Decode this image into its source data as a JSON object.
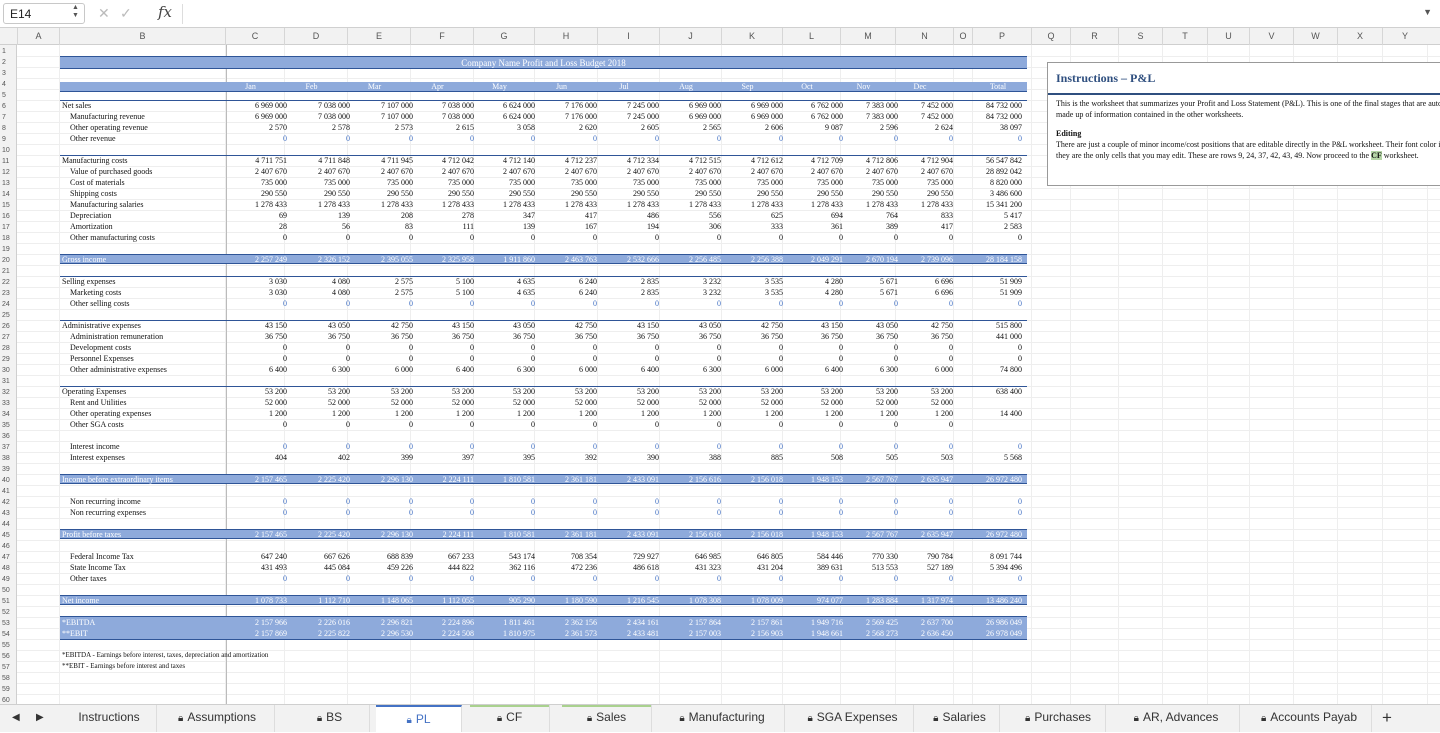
{
  "formula_bar": {
    "name_box": "E14",
    "cancel_icon": "✕",
    "enter_icon": "✓",
    "fx": "fx"
  },
  "columns": [
    "A",
    "B",
    "C",
    "D",
    "E",
    "F",
    "G",
    "H",
    "I",
    "J",
    "K",
    "L",
    "M",
    "N",
    "O",
    "P",
    "Q",
    "R",
    "S",
    "T",
    "U",
    "V",
    "W",
    "X",
    "Y"
  ],
  "rows": [
    "1",
    "2",
    "3",
    "4",
    "5",
    "6",
    "7",
    "8",
    "9",
    "10",
    "11",
    "12",
    "13",
    "14",
    "15",
    "16",
    "17",
    "18",
    "19",
    "20",
    "21",
    "22",
    "23",
    "24",
    "25",
    "26",
    "27",
    "28",
    "29",
    "30",
    "31",
    "32",
    "33",
    "34",
    "35",
    "36",
    "37",
    "38",
    "39",
    "40",
    "41",
    "42",
    "43",
    "44",
    "45",
    "46",
    "47",
    "48",
    "49",
    "50",
    "51",
    "52",
    "53",
    "54",
    "55",
    "56",
    "57",
    "58",
    "59",
    "60"
  ],
  "sheet": {
    "title": "Company Name Profit and Loss Budget 2018",
    "months": [
      "Jan",
      "Feb",
      "Mar",
      "Apr",
      "May",
      "Jun",
      "Jul",
      "Aug",
      "Sep",
      "Oct",
      "Nov",
      "Dec",
      "Total"
    ],
    "rows": [
      {
        "label": "Net sales",
        "type": "section",
        "values": [
          "6 969 000",
          "7 038 000",
          "7 107 000",
          "7 038 000",
          "6 624 000",
          "7 176 000",
          "7 245 000",
          "6 969 000",
          "6 969 000",
          "6 762 000",
          "7 383 000",
          "7 452 000",
          "84 732 000"
        ]
      },
      {
        "label": "Manufacturing revenue",
        "type": "sub",
        "values": [
          "6 969 000",
          "7 038 000",
          "7 107 000",
          "7 038 000",
          "6 624 000",
          "7 176 000",
          "7 245 000",
          "6 969 000",
          "6 969 000",
          "6 762 000",
          "7 383 000",
          "7 452 000",
          "84 732 000"
        ]
      },
      {
        "label": "Other operating revenue",
        "type": "sub",
        "values": [
          "2 570",
          "2 578",
          "2 573",
          "2 615",
          "3 058",
          "2 620",
          "2 605",
          "2 565",
          "2 606",
          "9 087",
          "2 596",
          "2 624",
          "38 097"
        ]
      },
      {
        "label": "Other revenue",
        "type": "sub",
        "blue": true,
        "values": [
          "0",
          "0",
          "0",
          "0",
          "0",
          "0",
          "0",
          "0",
          "0",
          "0",
          "0",
          "0",
          "0"
        ]
      },
      {
        "label": "Manufacturing costs",
        "type": "section",
        "values": [
          "4 711 751",
          "4 711 848",
          "4 711 945",
          "4 712 042",
          "4 712 140",
          "4 712 237",
          "4 712 334",
          "4 712 515",
          "4 712 612",
          "4 712 709",
          "4 712 806",
          "4 712 904",
          "56 547 842"
        ]
      },
      {
        "label": "Value of purchased goods",
        "type": "sub",
        "values": [
          "2 407 670",
          "2 407 670",
          "2 407 670",
          "2 407 670",
          "2 407 670",
          "2 407 670",
          "2 407 670",
          "2 407 670",
          "2 407 670",
          "2 407 670",
          "2 407 670",
          "2 407 670",
          "28 892 042"
        ]
      },
      {
        "label": "Cost of materials",
        "type": "sub",
        "values": [
          "735 000",
          "735 000",
          "735 000",
          "735 000",
          "735 000",
          "735 000",
          "735 000",
          "735 000",
          "735 000",
          "735 000",
          "735 000",
          "735 000",
          "8 820 000"
        ]
      },
      {
        "label": "Shipping costs",
        "type": "sub",
        "values": [
          "290 550",
          "290 550",
          "290 550",
          "290 550",
          "290 550",
          "290 550",
          "290 550",
          "290 550",
          "290 550",
          "290 550",
          "290 550",
          "290 550",
          "3 486 600"
        ]
      },
      {
        "label": "Manufacturing salaries",
        "type": "sub",
        "values": [
          "1 278 433",
          "1 278 433",
          "1 278 433",
          "1 278 433",
          "1 278 433",
          "1 278 433",
          "1 278 433",
          "1 278 433",
          "1 278 433",
          "1 278 433",
          "1 278 433",
          "1 278 433",
          "15 341 200"
        ]
      },
      {
        "label": "Depreciation",
        "type": "sub",
        "values": [
          "69",
          "139",
          "208",
          "278",
          "347",
          "417",
          "486",
          "556",
          "625",
          "694",
          "764",
          "833",
          "5 417"
        ]
      },
      {
        "label": "Amortization",
        "type": "sub",
        "values": [
          "28",
          "56",
          "83",
          "111",
          "139",
          "167",
          "194",
          "306",
          "333",
          "361",
          "389",
          "417",
          "2 583"
        ]
      },
      {
        "label": "Other manufacturing costs",
        "type": "sub",
        "values": [
          "0",
          "0",
          "0",
          "0",
          "0",
          "0",
          "0",
          "0",
          "0",
          "0",
          "0",
          "0",
          "0"
        ]
      },
      {
        "label": "Gross income",
        "type": "bar",
        "values": [
          "2 257 249",
          "2 326 152",
          "2 395 055",
          "2 325 958",
          "1 911 860",
          "2 463 763",
          "2 532 666",
          "2 256 485",
          "2 256 388",
          "2 049 291",
          "2 670 194",
          "2 739 096",
          "28 184 158"
        ]
      },
      {
        "label": "Selling expenses",
        "type": "section",
        "values": [
          "3 030",
          "4 080",
          "2 575",
          "5 100",
          "4 635",
          "6 240",
          "2 835",
          "3 232",
          "3 535",
          "4 280",
          "5 671",
          "6 696",
          "51 909"
        ]
      },
      {
        "label": "Marketing costs",
        "type": "sub",
        "values": [
          "3 030",
          "4 080",
          "2 575",
          "5 100",
          "4 635",
          "6 240",
          "2 835",
          "3 232",
          "3 535",
          "4 280",
          "5 671",
          "6 696",
          "51 909"
        ]
      },
      {
        "label": "Other selling costs",
        "type": "sub",
        "blue": true,
        "values": [
          "0",
          "0",
          "0",
          "0",
          "0",
          "0",
          "0",
          "0",
          "0",
          "0",
          "0",
          "0",
          "0"
        ]
      },
      {
        "label": "Administrative expenses",
        "type": "section",
        "values": [
          "43 150",
          "43 050",
          "42 750",
          "43 150",
          "43 050",
          "42 750",
          "43 150",
          "43 050",
          "42 750",
          "43 150",
          "43 050",
          "42 750",
          "515 800"
        ]
      },
      {
        "label": "Administration remuneration",
        "type": "sub",
        "values": [
          "36 750",
          "36 750",
          "36 750",
          "36 750",
          "36 750",
          "36 750",
          "36 750",
          "36 750",
          "36 750",
          "36 750",
          "36 750",
          "36 750",
          "441 000"
        ]
      },
      {
        "label": "Development costs",
        "type": "sub",
        "values": [
          "0",
          "0",
          "0",
          "0",
          "0",
          "0",
          "0",
          "0",
          "0",
          "0",
          "0",
          "0",
          "0"
        ]
      },
      {
        "label": "Personnel Expenses",
        "type": "sub",
        "values": [
          "0",
          "0",
          "0",
          "0",
          "0",
          "0",
          "0",
          "0",
          "0",
          "0",
          "0",
          "0",
          "0"
        ]
      },
      {
        "label": "Other administrative expenses",
        "type": "sub",
        "values": [
          "6 400",
          "6 300",
          "6 000",
          "6 400",
          "6 300",
          "6 000",
          "6 400",
          "6 300",
          "6 000",
          "6 400",
          "6 300",
          "6 000",
          "74 800"
        ]
      },
      {
        "label": "Operating Expenses",
        "type": "section",
        "values": [
          "53 200",
          "53 200",
          "53 200",
          "53 200",
          "53 200",
          "53 200",
          "53 200",
          "53 200",
          "53 200",
          "53 200",
          "53 200",
          "53 200",
          "638 400"
        ]
      },
      {
        "label": "Rent and Utilities",
        "type": "sub",
        "values": [
          "52 000",
          "52 000",
          "52 000",
          "52 000",
          "52 000",
          "52 000",
          "52 000",
          "52 000",
          "52 000",
          "52 000",
          "52 000",
          "52 000",
          ""
        ]
      },
      {
        "label": "Other operating expenses",
        "type": "sub",
        "values": [
          "1 200",
          "1 200",
          "1 200",
          "1 200",
          "1 200",
          "1 200",
          "1 200",
          "1 200",
          "1 200",
          "1 200",
          "1 200",
          "1 200",
          "14 400"
        ]
      },
      {
        "label": "Other SGA costs",
        "type": "sub",
        "values": [
          "0",
          "0",
          "0",
          "0",
          "0",
          "0",
          "0",
          "0",
          "0",
          "0",
          "0",
          "0",
          ""
        ]
      },
      {
        "label": "Interest income",
        "type": "sub",
        "blue": true,
        "values": [
          "0",
          "0",
          "0",
          "0",
          "0",
          "0",
          "0",
          "0",
          "0",
          "0",
          "0",
          "0",
          "0"
        ]
      },
      {
        "label": "Interest expenses",
        "type": "sub",
        "values": [
          "404",
          "402",
          "399",
          "397",
          "395",
          "392",
          "390",
          "388",
          "885",
          "508",
          "505",
          "503",
          "5 568"
        ]
      },
      {
        "label": "Income before extraordinary items",
        "type": "bar",
        "values": [
          "2 157 465",
          "2 225 420",
          "2 296 130",
          "2 224 111",
          "1 810 581",
          "2 361 181",
          "2 433 091",
          "2 156 616",
          "2 156 018",
          "1 948 153",
          "2 567 767",
          "2 635 947",
          "26 972 480"
        ]
      },
      {
        "label": "Non recurring income",
        "type": "sub",
        "blue": true,
        "values": [
          "0",
          "0",
          "0",
          "0",
          "0",
          "0",
          "0",
          "0",
          "0",
          "0",
          "0",
          "0",
          "0"
        ]
      },
      {
        "label": "Non recurring expenses",
        "type": "sub",
        "blue": true,
        "values": [
          "0",
          "0",
          "0",
          "0",
          "0",
          "0",
          "0",
          "0",
          "0",
          "0",
          "0",
          "0",
          "0"
        ]
      },
      {
        "label": "Profit before taxes",
        "type": "bar",
        "values": [
          "2 157 465",
          "2 225 420",
          "2 296 130",
          "2 224 111",
          "1 810 581",
          "2 361 181",
          "2 433 091",
          "2 156 616",
          "2 156 018",
          "1 948 153",
          "2 567 767",
          "2 635 947",
          "26 972 480"
        ]
      },
      {
        "label": "Federal Income Tax",
        "type": "sub",
        "values": [
          "647 240",
          "667 626",
          "688 839",
          "667 233",
          "543 174",
          "708 354",
          "729 927",
          "646 985",
          "646 805",
          "584 446",
          "770 330",
          "790 784",
          "8 091 744"
        ]
      },
      {
        "label": "State Income Tax",
        "type": "sub",
        "values": [
          "431 493",
          "445 084",
          "459 226",
          "444 822",
          "362 116",
          "472 236",
          "486 618",
          "431 323",
          "431 204",
          "389 631",
          "513 553",
          "527 189",
          "5 394 496"
        ]
      },
      {
        "label": "Other taxes",
        "type": "sub",
        "blue": true,
        "values": [
          "0",
          "0",
          "0",
          "0",
          "0",
          "0",
          "0",
          "0",
          "0",
          "0",
          "0",
          "0",
          "0"
        ]
      },
      {
        "label": "Net income",
        "type": "bar",
        "values": [
          "1 078 733",
          "1 112 710",
          "1 148 065",
          "1 112 055",
          "905 290",
          "1 180 590",
          "1 216 545",
          "1 078 308",
          "1 078 009",
          "974 077",
          "1 283 884",
          "1 317 974",
          "13 486 240"
        ]
      },
      {
        "label": "*EBITDA",
        "type": "ebit",
        "values": [
          "2 157 966",
          "2 226 016",
          "2 296 821",
          "2 224 896",
          "1 811 461",
          "2 362 156",
          "2 434 161",
          "2 157 864",
          "2 157 861",
          "1 949 716",
          "2 569 425",
          "2 637 700",
          "26 986 049"
        ]
      },
      {
        "label": "**EBIT",
        "type": "ebit",
        "values": [
          "2 157 869",
          "2 225 822",
          "2 296 530",
          "2 224 508",
          "1 810 975",
          "2 361 573",
          "2 433 481",
          "2 157 003",
          "2 156 903",
          "1 948 661",
          "2 568 273",
          "2 636 450",
          "26 978 049"
        ]
      }
    ],
    "notes": [
      "*EBITDA - Earnings before interest, taxes, depreciation and amortization",
      "**EBIT - Earnings before interest and taxes"
    ]
  },
  "instructions": {
    "title": "Instructions – P&L",
    "para1": "This is the worksheet that summarizes your Profit and Loss Statement (P&L). This is one of the final stages that are automatically made up of information contained in the other worksheets.",
    "editing_heading": "Editing",
    "para2_a": "There are just a couple of minor income/cost positions that are editable directly in the P&L worksheet. Their font color is ",
    "para2_blue": "blue",
    "para2_b": " and they are the only cells that you may edit. These are rows 9, 24, 37, 42, 43, 49. Now proceed to the ",
    "para2_cf": "CF",
    "para2_c": " worksheet."
  },
  "tabs": [
    {
      "label": "Instructions",
      "locked": false,
      "active": false,
      "accent": ""
    },
    {
      "label": "Assumptions",
      "locked": true,
      "active": false,
      "accent": ""
    },
    {
      "label": "BS",
      "locked": true,
      "active": false,
      "accent": ""
    },
    {
      "label": "PL",
      "locked": true,
      "active": true,
      "accent": "#4472c4"
    },
    {
      "label": "CF",
      "locked": true,
      "active": false,
      "accent": "#a9d18e"
    },
    {
      "label": "Sales",
      "locked": true,
      "active": false,
      "accent": "#a9d18e"
    },
    {
      "label": "Manufacturing",
      "locked": true,
      "active": false,
      "accent": ""
    },
    {
      "label": "SGA Expenses",
      "locked": true,
      "active": false,
      "accent": ""
    },
    {
      "label": "Salaries",
      "locked": true,
      "active": false,
      "accent": ""
    },
    {
      "label": "Purchases",
      "locked": true,
      "active": false,
      "accent": ""
    },
    {
      "label": "AR, Advances",
      "locked": true,
      "active": false,
      "accent": ""
    },
    {
      "label": "Accounts Payab",
      "locked": true,
      "active": false,
      "accent": ""
    }
  ],
  "add_sheet": "+"
}
